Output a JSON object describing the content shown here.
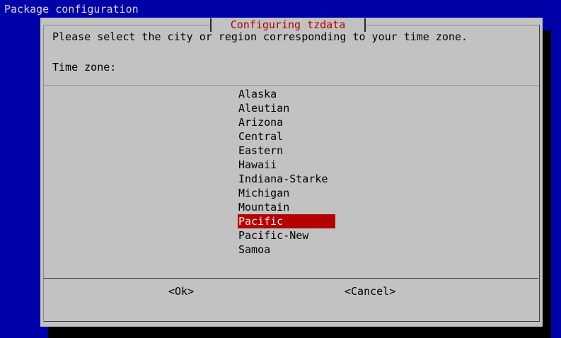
{
  "window": {
    "backtitle": "Package configuration"
  },
  "dialog": {
    "title": "Configuring tzdata",
    "prompt": "Please select the city or region corresponding to your time zone.",
    "label": "Time zone:"
  },
  "timezones": [
    "Alaska",
    "Aleutian",
    "Arizona",
    "Central",
    "Eastern",
    "Hawaii",
    "Indiana-Starke",
    "Michigan",
    "Mountain",
    "Pacific",
    "Pacific-New",
    "Samoa"
  ],
  "selected_timezone": "Pacific",
  "buttons": {
    "ok": "<Ok>",
    "cancel": "<Cancel>"
  },
  "colors": {
    "background": "#0000a8",
    "dialog": "#c2c2c2",
    "title": "#b00000",
    "selection": "#b40000"
  }
}
